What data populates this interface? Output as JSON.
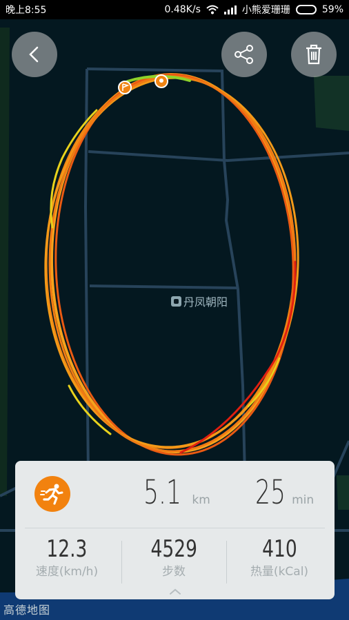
{
  "status_bar": {
    "time": "晚上8:55",
    "network_speed": "0.48K/s",
    "carrier": "小熊爱珊珊",
    "battery": "59%",
    "battery_level": 0.59
  },
  "map": {
    "place_label": "丹凤朝阳",
    "provider_logo": "高德地图",
    "route_colors": [
      "#f6a21c",
      "#f08413",
      "#ea5a12",
      "#e01f10",
      "#e8d21c",
      "#8fd22a"
    ]
  },
  "toolbar": {
    "back_icon": "chevron-left-icon",
    "share_icon": "share-icon",
    "delete_icon": "trash-icon"
  },
  "stats": {
    "activity_icon": "running-icon",
    "distance": {
      "value": "5.1",
      "unit": "km"
    },
    "duration": {
      "value": "25",
      "unit": "min"
    },
    "speed": {
      "value": "12.3",
      "label": "速度(km/h)"
    },
    "steps": {
      "value": "4529",
      "label": "步数"
    },
    "calories": {
      "value": "410",
      "label": "热量(kCal)"
    }
  },
  "colors": {
    "accent": "#f2820f",
    "card_bg": "#e6e9ea"
  }
}
